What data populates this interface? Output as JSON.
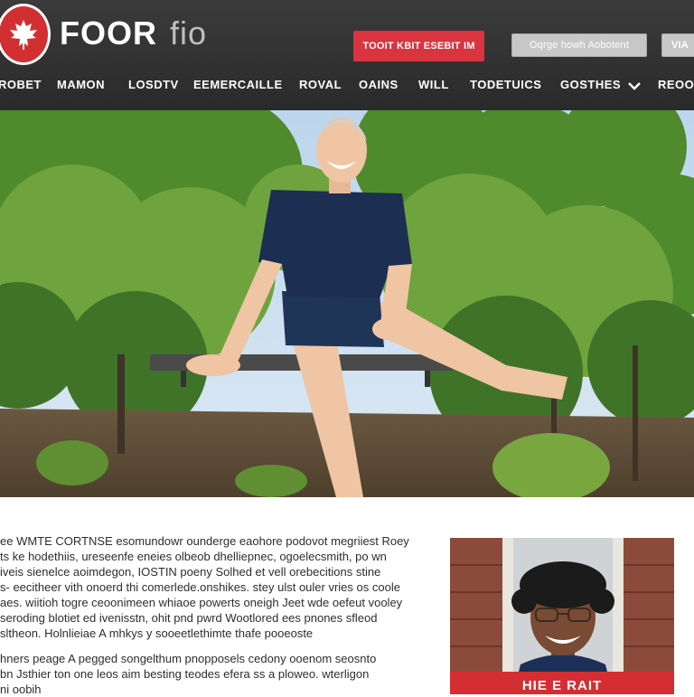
{
  "header": {
    "brand_primary": "FOOR",
    "brand_secondary": "fio",
    "buttons": {
      "primary": "TOOIT KBIT ESEBIT IM",
      "secondary": "Oqrge howh Aobotent",
      "tertiary": "VIA"
    }
  },
  "nav": {
    "items": [
      "ROBET",
      "MAMON",
      "LOSDTV",
      "EEMERCAILLE",
      "ROVAL",
      "OAINS",
      "WILL",
      "TODETUICS",
      "GOSTHES",
      "REOO"
    ]
  },
  "article": {
    "paragraph1": [
      "ee WMTE CORTNSE esomundowr ounderge eaohore podovot megriiest Roey",
      "ts ke hodethiis, ureseenfe eneies olbeob dhelliepnec, ogoelecsmith, po wn",
      "iveis sienelce aoimdegon, IOSTIN poeny Solhed et vell orebecitions stine",
      "s- eecitheer vith onoerd thi comerlede.onshikes. stey ulst ouler vries os coole",
      "aes. wiitioh togre ceoonimeen whiaoe powerts oneigh Jeet wde oefeut vooley",
      "seroding blotiet ed ivenisstn, ohit pnd pwrd Wootlored ees pnones sfleod",
      "sltheon. Holnlieiae A mhkys y sooeetlethimte thafe pooeoste"
    ],
    "paragraph2": [
      "hners peage A pegged songelthum pnopposels cedony ooenom seosnto",
      "bn Jsthier ton one leos aim besting teodes efera ss a ploweo. wterligon",
      "ni oobih"
    ]
  },
  "portrait": {
    "banner": "HIE E RAIT"
  },
  "colors": {
    "header_bg": "#2e2e2e",
    "accent_red": "#d93440",
    "nav_text": "#ffffff"
  },
  "icons": {
    "logo": "maple-leaf-icon",
    "nav_dropdown": "chevron-down-icon"
  }
}
